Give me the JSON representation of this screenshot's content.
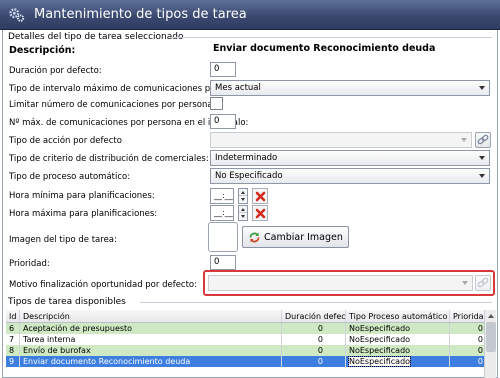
{
  "window": {
    "title": "Mantenimiento de tipos de tarea",
    "icon": "gear-icon"
  },
  "details": {
    "section_title": "Detalles del tipo de tarea seleccionado",
    "descripcion_label": "Descripción:",
    "descripcion_value": "Enviar documento Reconocimiento deuda",
    "duracion_label": "Duración por defecto:",
    "duracion_value": "0",
    "intervalo_label": "Tipo de intervalo máximo de comunicaciones por persona:",
    "intervalo_value": "Mes actual",
    "limitar_label": "Limitar número de comunicaciones por persona:",
    "num_max_label": "Nº máx. de comunicaciones por persona en el intervalo:",
    "num_max_value": "0",
    "tipo_accion_label": "Tipo de acción por defecto",
    "tipo_accion_value": "",
    "criterio_label": "Tipo de criterio de distribución de comerciales:",
    "criterio_value": "Indeterminado",
    "proceso_label": "Tipo de proceso automático:",
    "proceso_value": "No Especificado",
    "hora_min_label": "Hora mínima para planificaciones:",
    "hora_min_value": "__:__",
    "hora_max_label": "Hora máxima para planificaciones:",
    "hora_max_value": "__:__",
    "imagen_label": "Imagen del tipo de tarea:",
    "cambiar_imagen_button": "Cambiar Imagen",
    "prioridad_label": "Prioridad:",
    "prioridad_value": "0",
    "motivo_label": "Motivo finalización oportunidad por defecto:",
    "motivo_value": ""
  },
  "available": {
    "section_title": "Tipos de tarea disponibles",
    "columns": [
      "Id",
      "Descripción",
      "Duración defecto",
      "Tipo Proceso automático",
      "Prioridad"
    ],
    "rows": [
      {
        "id": "6",
        "descripcion": "Aceptación de presupuesto",
        "duracion": "0",
        "proceso": "NoEspecificado",
        "prioridad": "0",
        "style": "green"
      },
      {
        "id": "7",
        "descripcion": "Tarea interna",
        "duracion": "0",
        "proceso": "NoEspecificado",
        "prioridad": "0",
        "style": "white"
      },
      {
        "id": "8",
        "descripcion": "Envío de burofax",
        "duracion": "0",
        "proceso": "NoEspecificado",
        "prioridad": "0",
        "style": "green"
      },
      {
        "id": "9",
        "descripcion": "Enviar documento Reconocimiento deuda",
        "duracion": "0",
        "proceso": "NoEspecificado",
        "prioridad": "0",
        "style": "sel"
      }
    ]
  },
  "colors": {
    "title_bar": "#3b4a71",
    "row_green": "#cfe9c4",
    "row_selected": "#3d7ee0",
    "highlight_frame": "#d9373a",
    "delete_red": "#d32a1e"
  }
}
